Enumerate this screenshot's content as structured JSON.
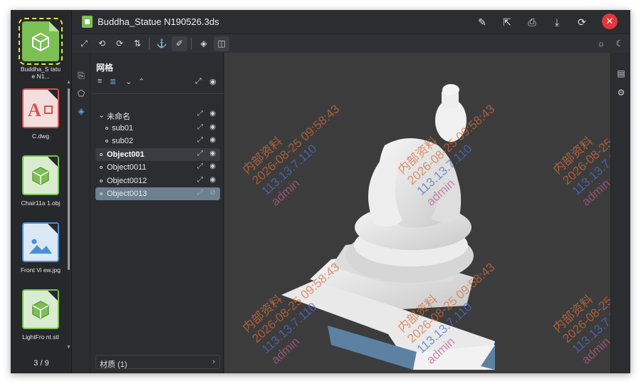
{
  "window": {
    "title": "Buddha_Statue N190526.3ds"
  },
  "file_strip": {
    "items": [
      {
        "label": "Buddha_S tatue N1...",
        "type": "3d-model",
        "color": "#7cbf55",
        "active": true
      },
      {
        "label": "C.dwg",
        "type": "cad",
        "color": "#d9534f",
        "active": false
      },
      {
        "label": "Chair11a 1.obj",
        "type": "3d-model",
        "color": "#7cbf55",
        "active": false
      },
      {
        "label": "Front Vi ew.jpg",
        "type": "image",
        "color": "#4a90d9",
        "active": false
      },
      {
        "label": "LightFro nt.stl",
        "type": "3d-model",
        "color": "#7cbf55",
        "active": false
      }
    ],
    "pager": "3 / 9"
  },
  "title_actions": [
    "edit-icon",
    "share-icon",
    "print-icon",
    "download-icon",
    "refresh-icon",
    "close-icon"
  ],
  "toolbar": {
    "tools": [
      "fullscreen-icon",
      "rotate-icon",
      "reset-rotate-icon",
      "swap-icon",
      "anchor-icon",
      "measure-icon",
      "cube-icon",
      "layout-icon"
    ],
    "right": [
      "sun-icon",
      "moon-icon"
    ]
  },
  "panel": {
    "title": "网格",
    "tree": [
      {
        "label": "未命名",
        "level": 0,
        "kind": "group",
        "state": "normal"
      },
      {
        "label": "sub01",
        "level": 1,
        "kind": "leaf",
        "state": "normal"
      },
      {
        "label": "sub02",
        "level": 1,
        "kind": "leaf",
        "state": "normal"
      },
      {
        "label": "Object001",
        "level": 0,
        "kind": "leaf",
        "state": "highlight"
      },
      {
        "label": "Object0011",
        "level": 0,
        "kind": "leaf",
        "state": "normal"
      },
      {
        "label": "Object0012",
        "level": 0,
        "kind": "leaf",
        "state": "normal"
      },
      {
        "label": "Object0013",
        "level": 0,
        "kind": "leaf",
        "state": "selected"
      }
    ],
    "material_label": "材质 (1)"
  },
  "watermark": {
    "line1": "内部资料",
    "line2": "2026-08-25 09:58:43",
    "line3": "113.13.7.110",
    "line4": "admin"
  },
  "colors": {
    "background": "#2b2d31",
    "viewport": "#3c3c3c",
    "selected_row": "#6c8090",
    "close_button": "#e0383c",
    "active_file_outline": "#e7e33a"
  }
}
